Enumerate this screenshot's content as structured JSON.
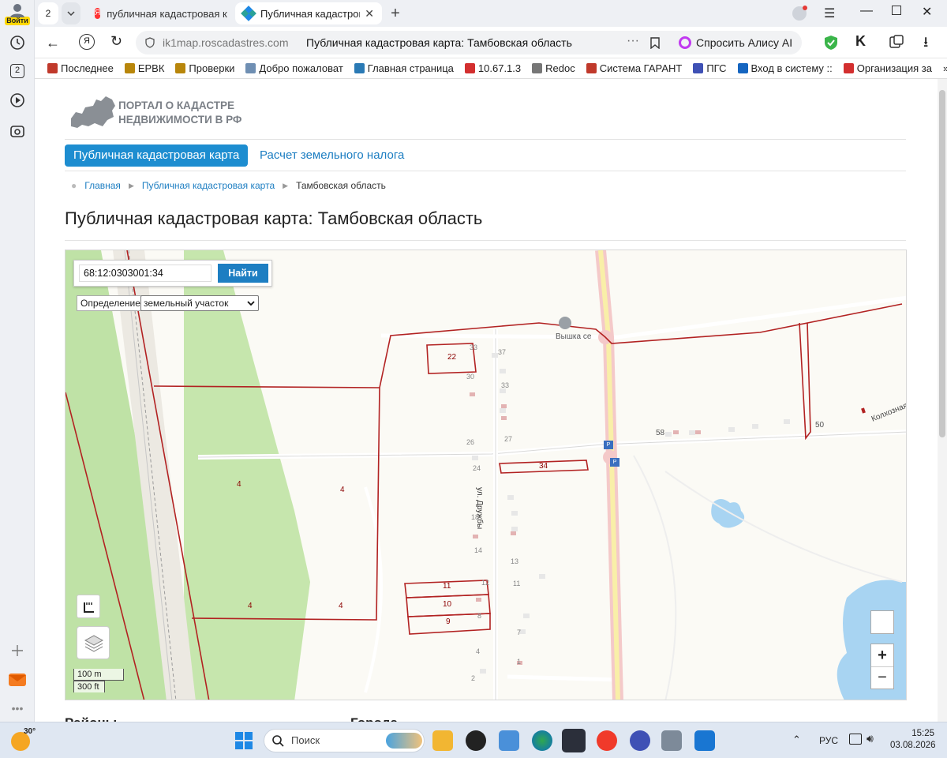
{
  "browser": {
    "login_label": "Войти",
    "tab_counter": "2",
    "rail_counter": "2",
    "tabs": [
      {
        "label": "публичная кадастровая к"
      },
      {
        "label": "Публичная кадастрова"
      }
    ],
    "url": "ik1map.roscadastres.com",
    "page_title": "Публичная кадастровая карта: Тамбовская область",
    "alice_label": "Спросить Алису AI",
    "bookmarks": [
      {
        "label": "Последнее",
        "color": "#c0392b"
      },
      {
        "label": "ЕРВК",
        "color": "#b8860b"
      },
      {
        "label": "Проверки",
        "color": "#b8860b"
      },
      {
        "label": "Добро пожаловат",
        "color": "#6f8fb3"
      },
      {
        "label": "Главная страница",
        "color": "#2a7ab5"
      },
      {
        "label": "10.67.1.3",
        "color": "#d32f2f"
      },
      {
        "label": "Redoc",
        "color": "#777777"
      },
      {
        "label": "Система ГАРАНТ",
        "color": "#c0392b"
      },
      {
        "label": "ПГС",
        "color": "#3f51b5"
      },
      {
        "label": "Вход в систему :: ",
        "color": "#1565c0"
      },
      {
        "label": "Организация за",
        "color": "#d32f2f"
      }
    ]
  },
  "site": {
    "logo_line1": "ПОРТАЛ О КАДАСТРЕ",
    "logo_line2": "НЕДВИЖИМОСТИ В РФ",
    "nav": [
      "Публичная кадастровая карта",
      "Расчет земельного налога"
    ],
    "breadcrumb": [
      "Главная",
      "Публичная кадастровая карта",
      "Тамбовская область"
    ],
    "heading": "Публичная кадастровая карта: Тамбовская область",
    "below_left": "Районы",
    "below_right": "Города"
  },
  "map": {
    "search_value": "68:12:0303001:34",
    "search_button": "Найти",
    "definition_label": "Определение:",
    "definition_value": "земельный участок",
    "scale_metric": "100 m",
    "scale_imperial": "300 ft",
    "zoom_in": "+",
    "zoom_out": "−",
    "poi_label": "Вышка се",
    "street_label": "ул. Дружбы",
    "road_label": "Колхозная",
    "parcel_labels": {
      "p22": "22",
      "p34": "34",
      "p11": "11",
      "p10": "10",
      "p9": "9",
      "n4a": "4",
      "n4b": "4",
      "n4c": "4",
      "n4d": "4",
      "n58": "58",
      "n50": "50"
    },
    "house_numbers": {
      "h33": "33",
      "h37": "37",
      "h30": "30",
      "h33b": "33",
      "h26": "26",
      "h27": "27",
      "h24": "24",
      "h18": "18",
      "h14": "14",
      "h13": "13",
      "h12": "12",
      "h11": "11",
      "h8": "8",
      "h7": "7",
      "h4": "4",
      "h1": "1",
      "h2": "2"
    }
  },
  "taskbar": {
    "weather": "30°",
    "search_placeholder": "Поиск",
    "lang": "РУС",
    "time": "15:25",
    "date": "03.08.2026"
  }
}
